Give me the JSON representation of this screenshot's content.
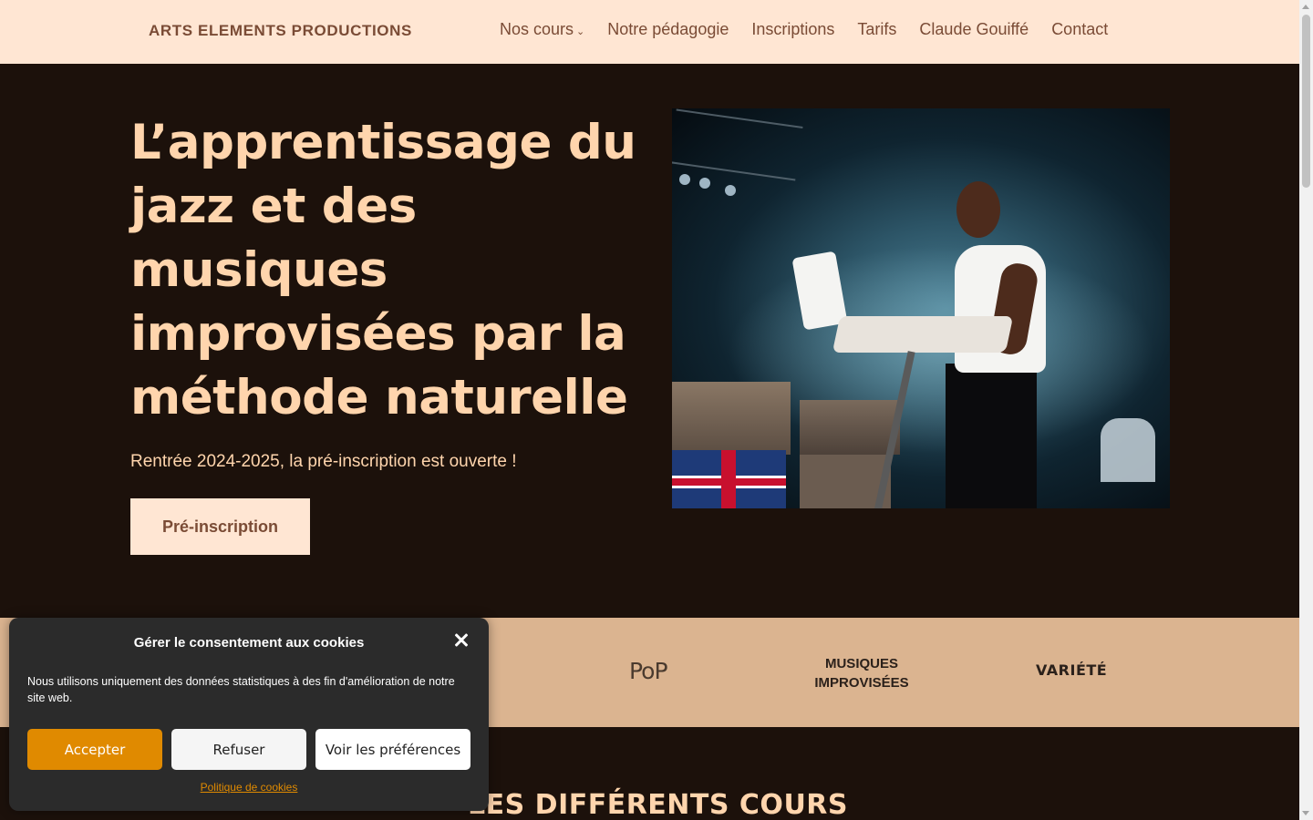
{
  "header": {
    "brand": "ARTS ELEMENTS PRODUCTIONS",
    "nav": [
      {
        "label": "Nos cours",
        "has_dropdown": true
      },
      {
        "label": "Notre pédagogie"
      },
      {
        "label": "Inscriptions"
      },
      {
        "label": "Tarifs"
      },
      {
        "label": "Claude Gouiffé"
      },
      {
        "label": "Contact"
      }
    ]
  },
  "hero": {
    "title": "L’apprentissage du jazz et des musiques improvisées par la méthode naturelle",
    "subtitle": "Rentrée 2024-2025, la pré-inscription est ouverte !",
    "cta_label": "Pré-inscription"
  },
  "genres": {
    "partial": "y",
    "items": [
      "PoP",
      "MUSIQUES IMPROVISÉES",
      "VARIÉTÉ"
    ]
  },
  "section": {
    "title": "LES DIFFÉRENTS COURS"
  },
  "cookie_banner": {
    "title": "Gérer le consentement aux cookies",
    "text": "Nous utilisons uniquement des données statistiques à des fin d'amélioration de notre site web.",
    "accept_label": "Accepter",
    "refuse_label": "Refuser",
    "prefs_label": "Voir les préférences",
    "policy_link": "Politique de cookies"
  },
  "colors": {
    "header_bg": "#ffe6d3",
    "page_bg": "#1c110b",
    "accent_text": "#ffd5ad",
    "brand_brown": "#7a4b35",
    "genres_bg": "#dbb490",
    "cookie_bg": "#2b2b2b",
    "accept_orange": "#e08a00"
  }
}
